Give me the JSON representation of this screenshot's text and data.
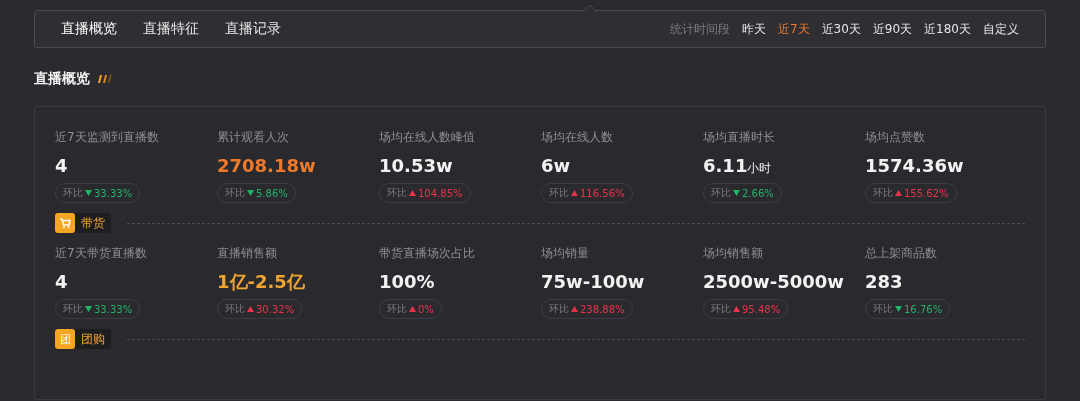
{
  "nav": {
    "tabs": [
      {
        "label": "直播概览",
        "selected": true
      },
      {
        "label": "直播特征",
        "selected": false
      },
      {
        "label": "直播记录",
        "selected": false
      }
    ],
    "period_label": "统计时间段",
    "periods": [
      {
        "label": "昨天",
        "selected": false
      },
      {
        "label": "近7天",
        "selected": true
      },
      {
        "label": "近30天",
        "selected": false
      },
      {
        "label": "近90天",
        "selected": false
      },
      {
        "label": "近180天",
        "selected": false
      },
      {
        "label": "自定义",
        "selected": false
      }
    ]
  },
  "section_title": "直播概览",
  "groups": [
    {
      "metrics": [
        {
          "label": "近7天监测到直播数",
          "value": "4",
          "trend_label": "环比",
          "rising": false,
          "change": "33.33%"
        },
        {
          "label": "累计观看人次",
          "value": "2708.18w",
          "color": "#f07a2a",
          "trend_label": "环比",
          "rising": false,
          "change": "5.86%"
        },
        {
          "label": "场均在线人数峰值",
          "value": "10.53w",
          "trend_label": "环比",
          "rising": true,
          "change": "104.85%"
        },
        {
          "label": "场均在线人数",
          "value": "6w",
          "trend_label": "环比",
          "rising": true,
          "change": "116.56%"
        },
        {
          "label": "场均直播时长",
          "value": "6.11",
          "unit": "小时",
          "trend_label": "环比",
          "rising": false,
          "change": "2.66%"
        },
        {
          "label": "场均点赞数",
          "value": "1574.36w",
          "trend_label": "环比",
          "rising": true,
          "change": "155.62%"
        }
      ]
    },
    {
      "tag": {
        "kind": "cart",
        "label": "带货"
      },
      "metrics": [
        {
          "label": "近7天带货直播数",
          "value": "4",
          "trend_label": "环比",
          "rising": false,
          "change": "33.33%"
        },
        {
          "label": "直播销售额",
          "value": "1亿-2.5亿",
          "color": "#f0a530",
          "trend_label": "环比",
          "rising": true,
          "change": "30.32%"
        },
        {
          "label": "带货直播场次占比",
          "value": "100%",
          "trend_label": "环比",
          "rising": true,
          "change": "0%"
        },
        {
          "label": "场均销量",
          "value": "75w-100w",
          "trend_label": "环比",
          "rising": true,
          "change": "238.88%"
        },
        {
          "label": "场均销售额",
          "value": "2500w-5000w",
          "trend_label": "环比",
          "rising": true,
          "change": "95.48%"
        },
        {
          "label": "总上架商品数",
          "value": "283",
          "trend_label": "环比",
          "rising": false,
          "change": "16.76%"
        }
      ]
    },
    {
      "tag": {
        "kind": "glyph",
        "glyph": "团",
        "label": "团购"
      }
    }
  ]
}
